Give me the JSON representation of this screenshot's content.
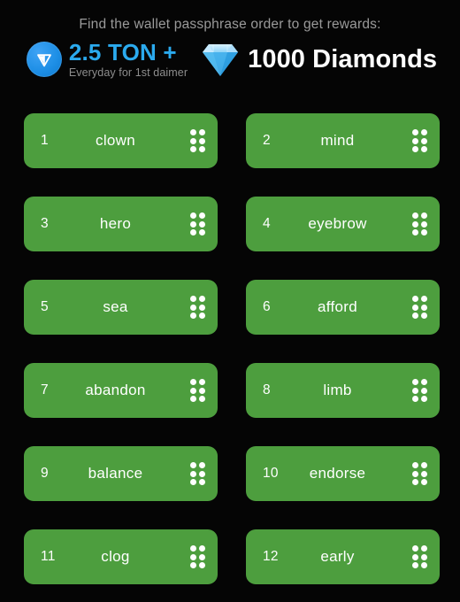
{
  "header": {
    "headline": "Find the wallet passphrase order to get rewards:",
    "rewards": {
      "ton": {
        "icon": "ton-coin-icon",
        "amount": "2.5 TON +",
        "subtitle": "Everyday for 1st daimer",
        "color": "#2BAAEE"
      },
      "diamonds": {
        "icon": "diamond-gem-icon",
        "amount": "1000 Diamonds",
        "color": "#FFFFFF"
      }
    }
  },
  "theme": {
    "background": "#050505",
    "card_green": "#4d9e3e",
    "card_text": "#FFFFFF",
    "headline_gray": "#9a9a9a"
  },
  "word_list": {
    "handle_icon": "drag-handle-icon",
    "items": [
      {
        "index": "1",
        "word": "clown"
      },
      {
        "index": "2",
        "word": "mind"
      },
      {
        "index": "3",
        "word": "hero"
      },
      {
        "index": "4",
        "word": "eyebrow"
      },
      {
        "index": "5",
        "word": "sea"
      },
      {
        "index": "6",
        "word": "afford"
      },
      {
        "index": "7",
        "word": "abandon"
      },
      {
        "index": "8",
        "word": "limb"
      },
      {
        "index": "9",
        "word": "balance"
      },
      {
        "index": "10",
        "word": "endorse"
      },
      {
        "index": "11",
        "word": "clog"
      },
      {
        "index": "12",
        "word": "early"
      }
    ]
  }
}
